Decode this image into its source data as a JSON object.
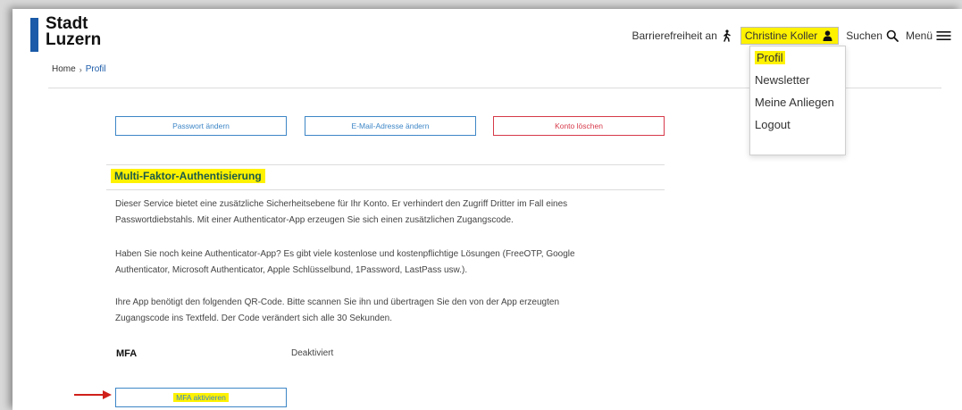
{
  "header": {
    "logo_line1": "Stadt",
    "logo_line2": "Luzern",
    "accessibility_label": "Barrierefreiheit an",
    "user_name": "Christine Koller",
    "search_label": "Suchen",
    "menu_label": "Menü"
  },
  "breadcrumb": {
    "home": "Home",
    "current": "Profil"
  },
  "user_menu": {
    "items": [
      "Profil",
      "Newsletter",
      "Meine Anliegen",
      "Logout"
    ],
    "highlighted": "Profil"
  },
  "actions": {
    "change_password": "Passwort ändern",
    "change_email": "E-Mail-Adresse ändern",
    "delete_account": "Konto löschen"
  },
  "mfa_section": {
    "title": "Multi-Faktor-Authentisierung",
    "para1_line1": "Dieser Service bietet eine zusätzliche Sicherheitsebene für Ihr Konto. Er verhindert den Zugriff Dritter im Fall eines",
    "para1_line2": "Passwortdiebstahls. Mit einer Authenticator-App erzeugen Sie sich einen zusätzlichen Zugangscode.",
    "para2_line1": "Haben Sie noch keine Authenticator-App? Es gibt viele kostenlose und kostenpflichtige Lösungen (FreeOTP, Google",
    "para2_line2": "Authenticator, Microsoft Authenticator, Apple Schlüsselbund, 1Password, LastPass usw.).",
    "para3_line1": "Ihre App benötigt den folgenden QR-Code. Bitte scannen Sie ihn und übertragen Sie den von der App erzeugten",
    "para3_line2": "Zugangscode ins Textfeld. Der Code verändert sich alle 30 Sekunden.",
    "status_key": "MFA",
    "status_value": "Deaktiviert",
    "activate_button": "MFA aktivieren"
  },
  "colors": {
    "brand_blue": "#1a5aa8",
    "link_blue": "#3d86c6",
    "danger_red": "#d63a4a",
    "highlight_yellow": "#fff200",
    "annotation_arrow": "#d0201a"
  },
  "icons": [
    "walking-person-icon",
    "user-icon",
    "search-icon",
    "hamburger-menu-icon",
    "chevron-right-icon",
    "red-arrow-annotation"
  ]
}
